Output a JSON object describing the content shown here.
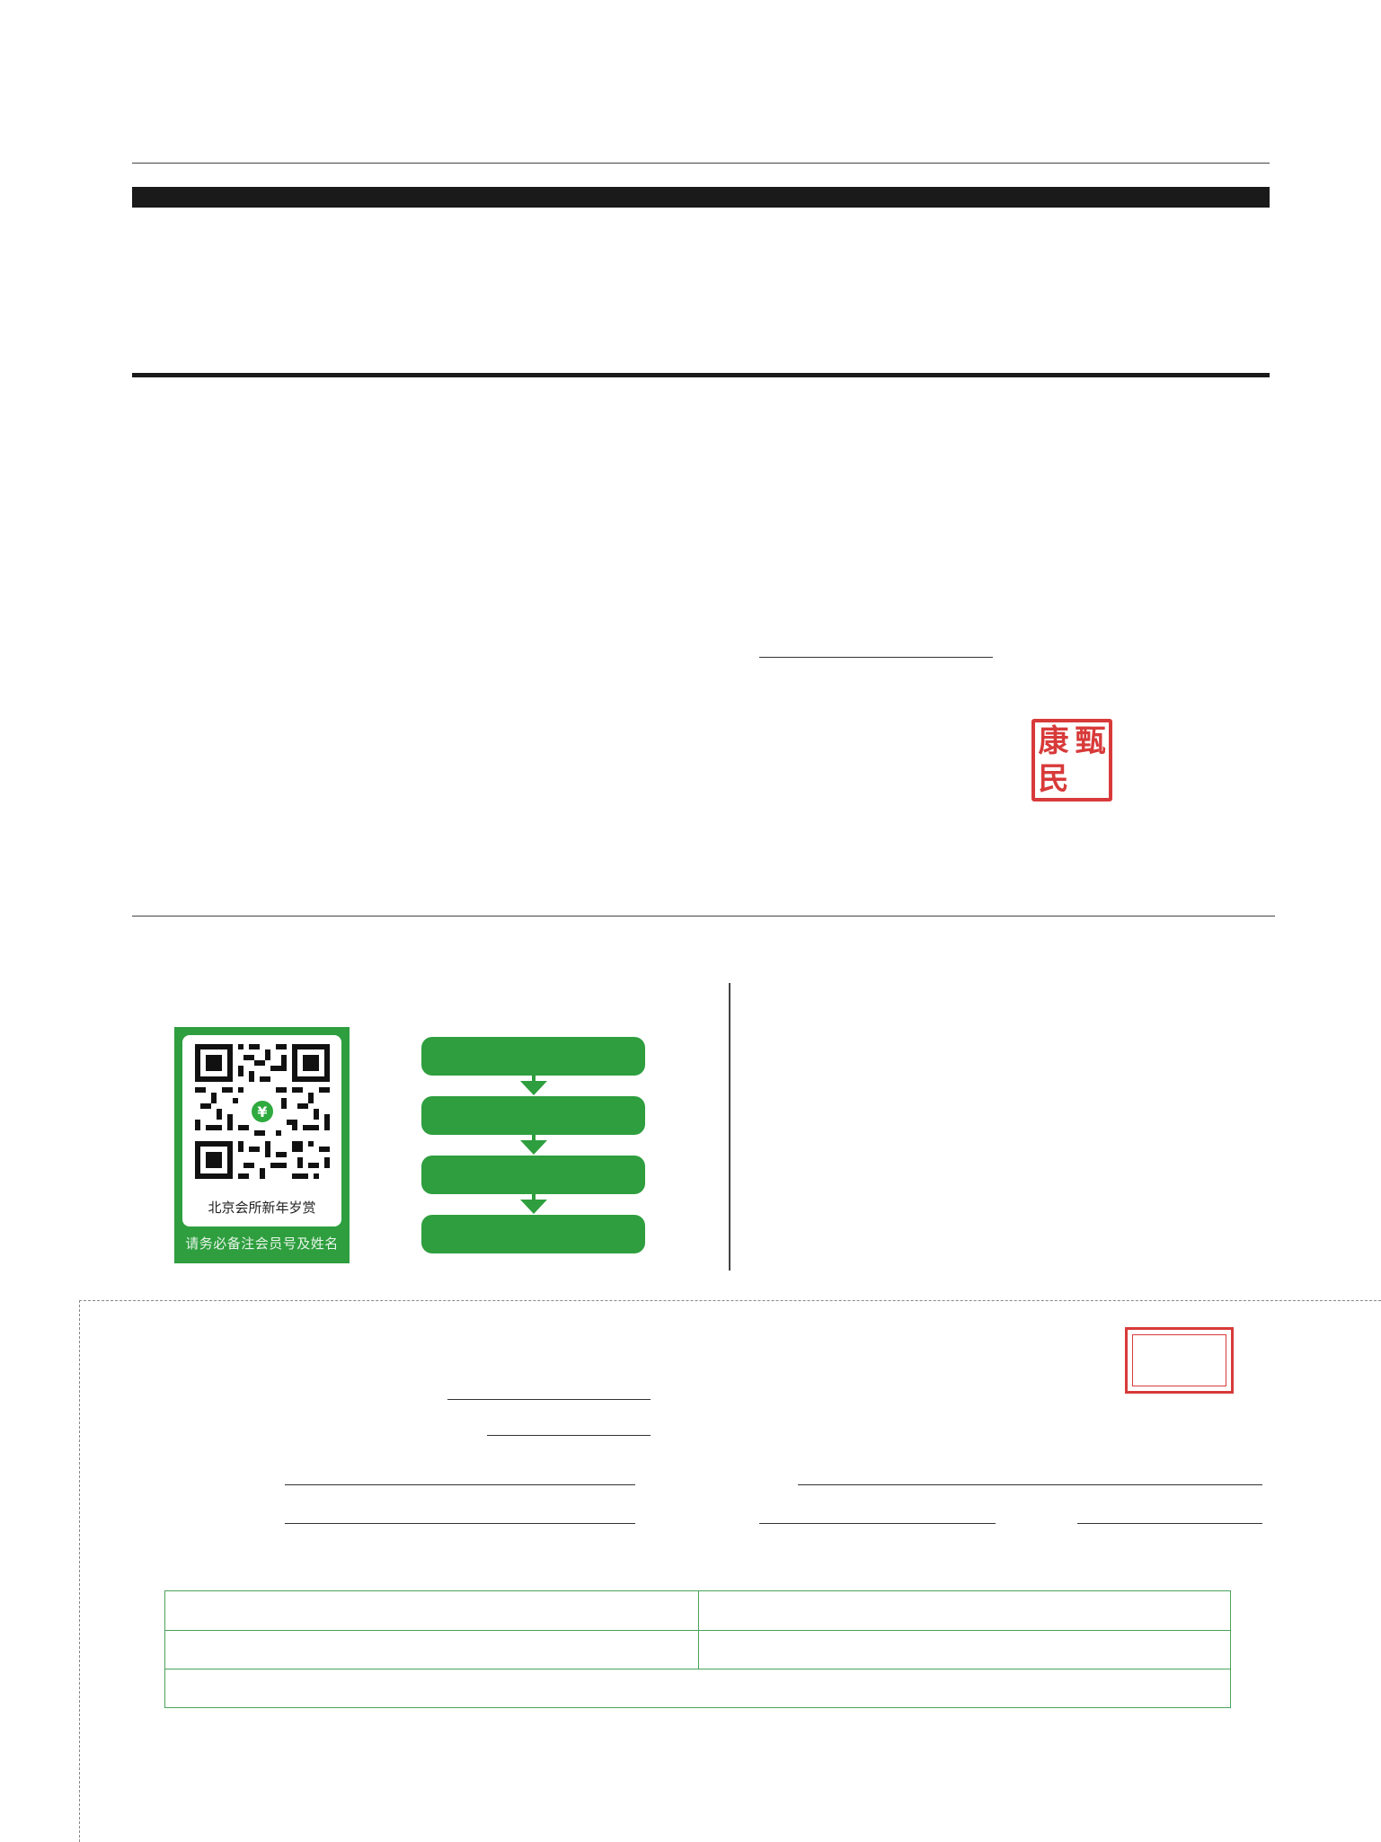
{
  "seal": {
    "chars": [
      "康",
      "甄",
      "民",
      ""
    ]
  },
  "qr_card": {
    "center_symbol": "¥",
    "caption": "北京会所新年岁赏",
    "footer": "请务必备注会员号及姓名"
  },
  "flow": {
    "step_count": 4
  },
  "colors": {
    "green": "#2e9e3e",
    "seal_red": "#d83a3a"
  },
  "icons": {
    "qr": "qr-code-icon",
    "pay": "yuan-icon",
    "arrow": "arrow-down-icon"
  }
}
